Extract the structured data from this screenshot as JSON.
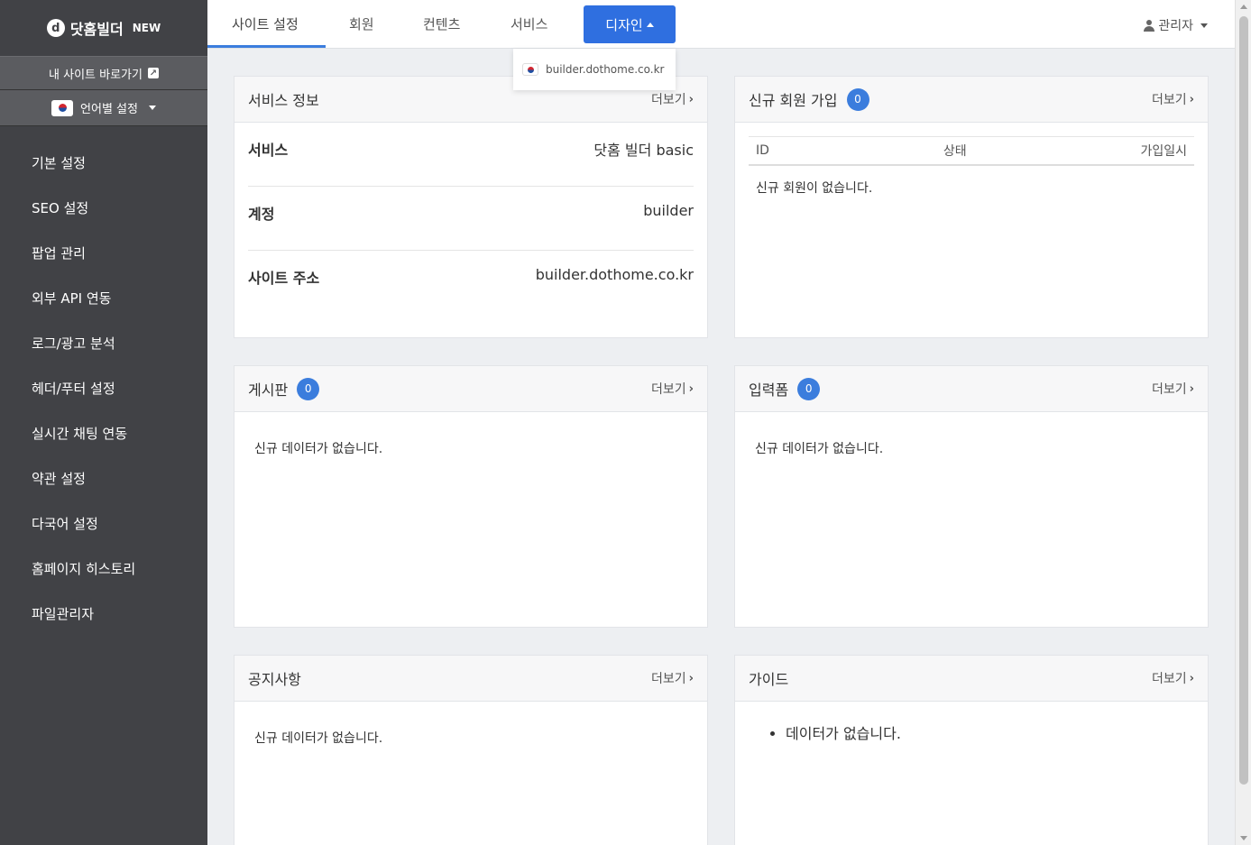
{
  "brand": {
    "name": "닷홈빌더",
    "tag": "NEW",
    "mark": "d"
  },
  "sidebar": {
    "shortcut_label": "내 사이트 바로가기",
    "language_label": "언어별 설정",
    "items": [
      {
        "label": "기본 설정"
      },
      {
        "label": "SEO 설정"
      },
      {
        "label": "팝업 관리"
      },
      {
        "label": "외부 API 연동"
      },
      {
        "label": "로그/광고 분석"
      },
      {
        "label": "헤더/푸터 설정"
      },
      {
        "label": "실시간 채팅 연동"
      },
      {
        "label": "약관 설정"
      },
      {
        "label": "다국어 설정"
      },
      {
        "label": "홈페이지 히스토리"
      },
      {
        "label": "파일관리자"
      }
    ]
  },
  "topnav": {
    "tabs": [
      {
        "label": "사이트 설정"
      },
      {
        "label": "회원"
      },
      {
        "label": "컨텐츠"
      },
      {
        "label": "서비스"
      },
      {
        "label": "디자인"
      }
    ],
    "admin_label": "관리자",
    "dropdown_item": "builder.dothome.co.kr"
  },
  "panels": {
    "more_label": "더보기",
    "service_info": {
      "title": "서비스 정보",
      "rows": [
        {
          "label": "서비스",
          "value": "닷홈 빌더 basic"
        },
        {
          "label": "계정",
          "value": "builder"
        },
        {
          "label": "사이트 주소",
          "value": "builder.dothome.co.kr"
        }
      ]
    },
    "new_members": {
      "title": "신규 회원 가입",
      "count": "0",
      "columns": [
        "ID",
        "상태",
        "가입일시"
      ],
      "empty": "신규 회원이 없습니다."
    },
    "board": {
      "title": "게시판",
      "count": "0",
      "empty": "신규 데이터가 없습니다."
    },
    "form": {
      "title": "입력폼",
      "count": "0",
      "empty": "신규 데이터가 없습니다."
    },
    "notice": {
      "title": "공지사항",
      "empty": "신규 데이터가 없습니다."
    },
    "guide": {
      "title": "가이드",
      "items": [
        "데이터가 없습니다."
      ]
    }
  },
  "colors": {
    "sidebar_bg": "#414246",
    "accent": "#3b7ddd",
    "design_tab": "#2f6fe0"
  }
}
